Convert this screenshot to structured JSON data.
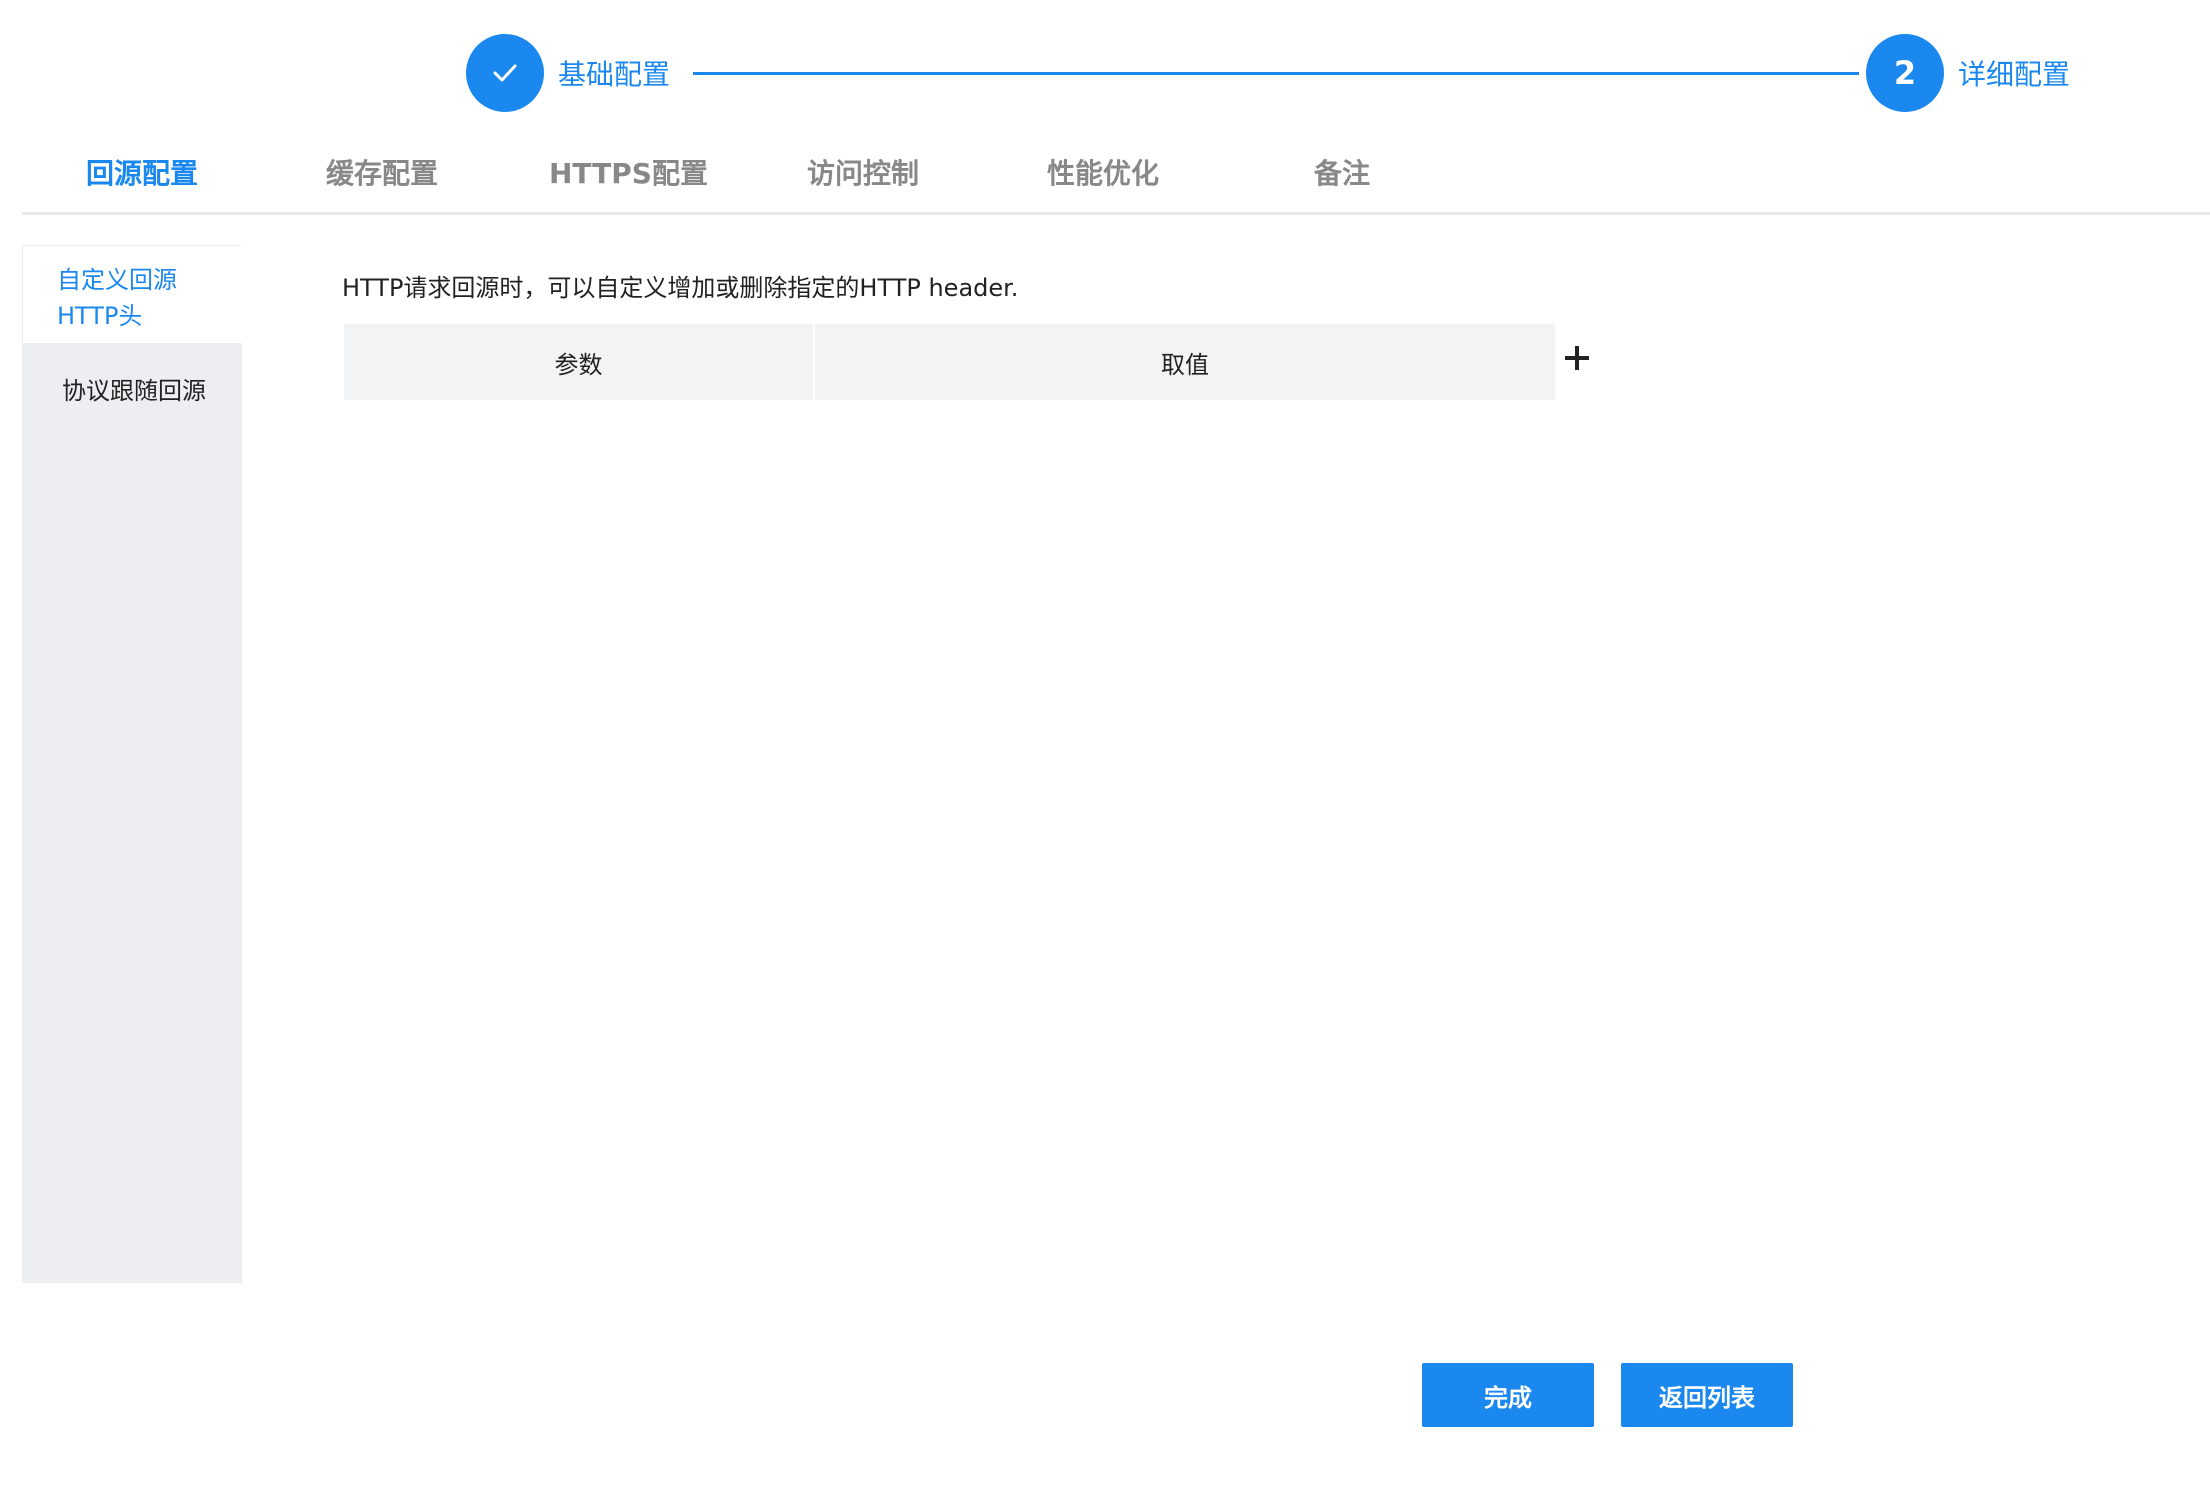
{
  "stepper": {
    "steps": [
      {
        "label": "基础配置",
        "status": "completed",
        "icon": "check-icon"
      },
      {
        "label": "详细配置",
        "status": "current",
        "number": "2"
      }
    ]
  },
  "tabs": [
    {
      "label": "回源配置",
      "active": true
    },
    {
      "label": "缓存配置",
      "active": false
    },
    {
      "label": "HTTPS配置",
      "active": false
    },
    {
      "label": "访问控制",
      "active": false
    },
    {
      "label": "性能优化",
      "active": false
    },
    {
      "label": "备注",
      "active": false
    }
  ],
  "side_menu": {
    "items": [
      {
        "label_line1": "自定义回源",
        "label_line2": "HTTP头",
        "active": true
      },
      {
        "label": "协议跟随回源",
        "active": false
      }
    ]
  },
  "content": {
    "description": "HTTP请求回源时，可以自定义增加或删除指定的HTTP header.",
    "table": {
      "columns": [
        "参数",
        "取值"
      ],
      "rows": []
    },
    "add_icon": "plus-icon"
  },
  "buttons": {
    "finish": "完成",
    "back_to_list": "返回列表"
  },
  "colors": {
    "accent": "#1a88ee",
    "tab_inactive": "#888888",
    "table_header_bg": "#f2f3f5",
    "side_menu_bg": "#eceef2"
  }
}
